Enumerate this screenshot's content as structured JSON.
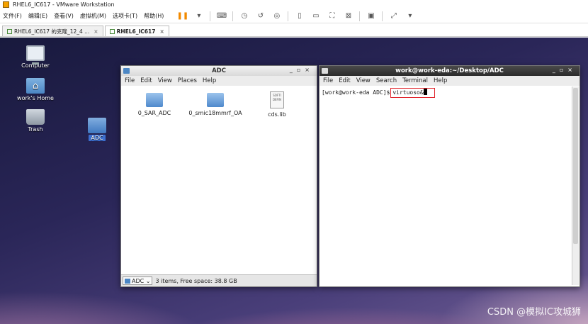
{
  "vmware": {
    "title": "RHEL6_IC617 - VMware Workstation",
    "menu": [
      "文件(F)",
      "编辑(E)",
      "查看(V)",
      "虚拟机(M)",
      "选项卡(T)",
      "帮助(H)"
    ],
    "tabs": [
      {
        "label": "RHEL6_IC617 的克隆_12_4 ...",
        "active": false
      },
      {
        "label": "RHEL6_IC617",
        "active": true
      }
    ]
  },
  "desktop": {
    "icons": [
      {
        "label": "Computer",
        "icon": "computer-icon"
      },
      {
        "label": "work's Home",
        "icon": "home-folder-icon"
      },
      {
        "label": "Trash",
        "icon": "trash-icon"
      },
      {
        "label": "ADC",
        "icon": "folder-icon"
      }
    ]
  },
  "file_manager": {
    "title": "ADC",
    "menu": [
      "File",
      "Edit",
      "View",
      "Places",
      "Help"
    ],
    "items": [
      {
        "label": "0_SAR_ADC",
        "type": "folder"
      },
      {
        "label": "0_smic18mmrf_OA",
        "type": "folder"
      },
      {
        "label": "cds.lib",
        "type": "file"
      }
    ],
    "file_icon_text": [
      "SOFTI",
      "DEFIN"
    ],
    "location": "ADC",
    "status": "3 items, Free space: 38.8 GB"
  },
  "terminal": {
    "title": "work@work-eda:~/Desktop/ADC",
    "menu": [
      "File",
      "Edit",
      "View",
      "Search",
      "Terminal",
      "Help"
    ],
    "prompt": "[work@work-eda ADC]$",
    "command": "virtuoso&"
  },
  "watermark": "CSDN @模拟IC攻城狮",
  "colors": {
    "highlight": "#e0222a",
    "pause": "#f28a00"
  }
}
